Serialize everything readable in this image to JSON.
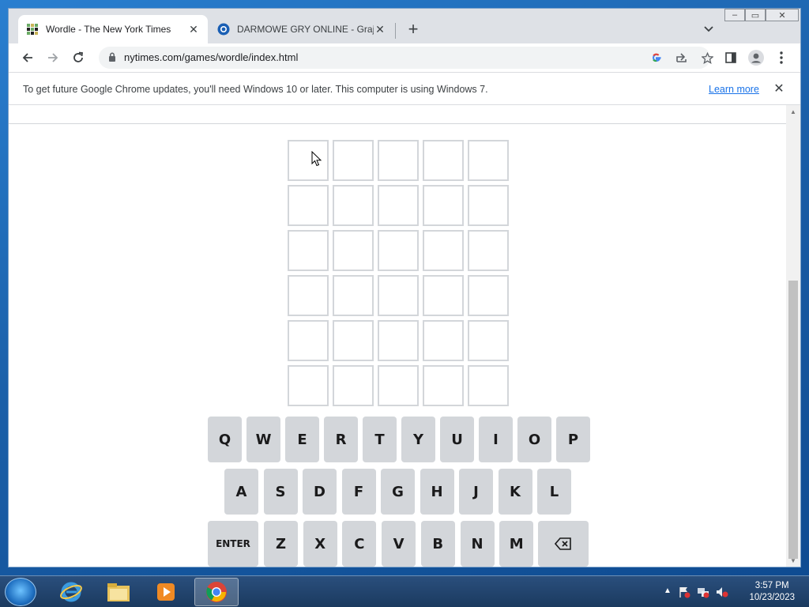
{
  "browser": {
    "tabs": [
      {
        "title": "Wordle - The New York Times",
        "active": true,
        "icon": "wordle-grid-icon"
      },
      {
        "title": "DARMOWE GRY ONLINE - Graj w",
        "active": false,
        "icon": "gry-online-icon"
      }
    ],
    "url": "nytimes.com/games/wordle/index.html",
    "infobar": {
      "message": "To get future Google Chrome updates, you'll need Windows 10 or later. This computer is using Windows 7.",
      "link": "Learn more"
    }
  },
  "board": {
    "rows": 6,
    "cols": 5,
    "guesses": []
  },
  "keyboard": {
    "row1": [
      "Q",
      "W",
      "E",
      "R",
      "T",
      "Y",
      "U",
      "I",
      "O",
      "P"
    ],
    "row2": [
      "A",
      "S",
      "D",
      "F",
      "G",
      "H",
      "J",
      "K",
      "L"
    ],
    "row3": [
      "ENTER",
      "Z",
      "X",
      "C",
      "V",
      "B",
      "N",
      "M",
      "⌫"
    ]
  },
  "taskbar": {
    "apps": [
      "start-orb",
      "internet-explorer-icon",
      "file-explorer-icon",
      "media-player-icon",
      "chrome-icon"
    ],
    "time": "3:57 PM",
    "date": "10/23/2023"
  },
  "colors": {
    "key_bg": "#d3d6da",
    "tile_border": "#d3d6da",
    "accent_link": "#1a73e8"
  }
}
